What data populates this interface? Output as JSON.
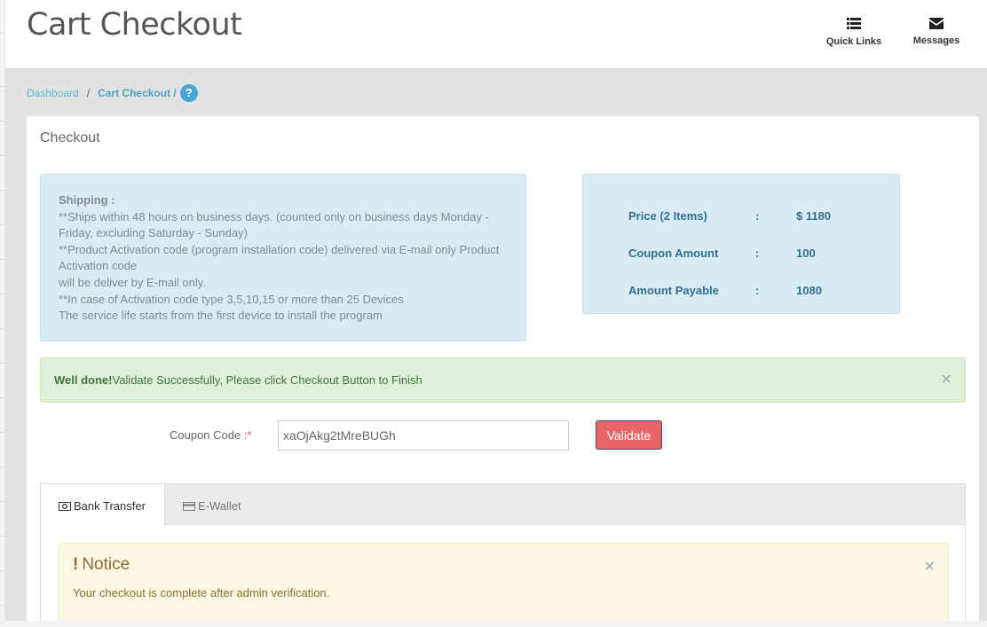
{
  "header": {
    "title": "Cart Checkout",
    "quick_links_label": "Quick Links",
    "messages_label": "Messages"
  },
  "breadcrumb": {
    "home": "Dashboard",
    "separator": "/",
    "current": "Cart Checkout /",
    "help": "?"
  },
  "panel": {
    "title": "Checkout"
  },
  "shipping": {
    "heading": "Shipping :",
    "lines": [
      "**Ships within 48 hours on business days. (counted only on business days Monday - Friday, excluding Saturday - Sunday)",
      "**Product Activation code (program installation code) delivered via E-mail only Product Activation code",
      "will be deliver by E-mail only.",
      "**In case of Activation code type 3,5,10,15 or more than 25 Devices",
      "The service life starts from the first device to install the program"
    ]
  },
  "summary": {
    "rows": [
      {
        "label": "Price (2 Items)",
        "colon": ":",
        "value": "$ 1180"
      },
      {
        "label": "Coupon Amount",
        "colon": ":",
        "value": "100"
      },
      {
        "label": "Amount Payable",
        "colon": ":",
        "value": "1080"
      }
    ]
  },
  "alert": {
    "strong": "Well done!",
    "text": "Validate Successfully, Please click Checkout Button to Finish",
    "close": "×"
  },
  "coupon": {
    "label": "Coupon Code :",
    "required_mark": "*",
    "value": "xaOjAkg2tMreBUGh",
    "button": "Validate"
  },
  "tabs": [
    {
      "label": "Bank Transfer",
      "icon": "money-icon",
      "active": true
    },
    {
      "label": "E-Wallet",
      "icon": "credit-card-icon",
      "active": false
    }
  ],
  "notice": {
    "title": "Notice",
    "bang": "!",
    "text": "Your checkout is complete after admin verification.",
    "close": "×"
  },
  "colors": {
    "accent_link": "#5bb8d4",
    "help_badge": "#48a6d6",
    "info_bg": "#d9ecf6",
    "success_bg": "#dff0d8",
    "warning_bg": "#fcf8e3",
    "validate_btn": "#e86666"
  }
}
